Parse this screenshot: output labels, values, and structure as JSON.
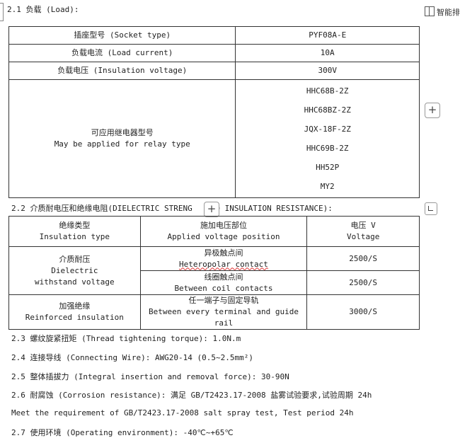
{
  "section_1": {
    "heading": "2.1 负载 (Load):",
    "rows": [
      {
        "label": "插座型号 (Socket type)",
        "value": "PYF08A-E"
      },
      {
        "label": "负载电流 (Load current)",
        "value": "10A"
      },
      {
        "label": "负载电压 (Insulation voltage)",
        "value": "300V"
      }
    ],
    "relay_label_cn": "可应用继电器型号",
    "relay_label_en": "May be applied for relay type",
    "relay_types": [
      "HHC68B-2Z",
      "HHC68BZ-2Z",
      "JQX-18F-2Z",
      "HHC69B-2Z",
      "HH52P",
      "MY2"
    ]
  },
  "section_2": {
    "heading": "2.2 介质耐电压和绝缘电阻(DIELECTRIC STRENG",
    "heading_tail": "ND INSULATION RESISTANCE):",
    "headers": [
      {
        "cn": "绝缘类型",
        "en": "Insulation type"
      },
      {
        "cn": "施加电压部位",
        "en": "Applied voltage position"
      },
      {
        "cn": "电压 V",
        "en": "Voltage"
      }
    ],
    "dielectric_cn": "介质耐压",
    "dielectric_en1": "Dielectric",
    "dielectric_en2": "withstand voltage",
    "hetero_cn": "异极触点间",
    "hetero_en": "Heteropolar contact",
    "hetero_voltage": "2500/S",
    "coil_cn": "线圈触点间",
    "coil_en": "Between coil contacts",
    "coil_voltage": "2500/S",
    "reinforced_cn": "加强绝缘",
    "reinforced_en": "Reinforced insulation",
    "terminal_cn": "任一端子与固定导轨",
    "terminal_en": "Between every terminal and guide rail",
    "terminal_voltage": "3000/S"
  },
  "lines": {
    "l1": "2.3 螺纹旋紧扭矩 (Thread tightening torque): 1.0N.m",
    "l2": "2.4 连接导线 (Connecting Wire): AWG20-14 (0.5~2.5mm²)",
    "l3": "2.5 整体插拔力 (Integral insertion and removal force): 30-90N",
    "l4": "2.6 耐腐蚀 (Corrosion resistance): 满足 GB/T2423.17-2008 盐雾试验要求,试验周期 24h",
    "l5": "Meet the requirement of GB/T2423.17-2008 salt spray test, Test period 24h",
    "l6": "2.7 使用环境 (Operating environment): -40℃~+65℃"
  },
  "toolbar": {
    "smart_label": "智能排",
    "plus_glyph": "+"
  },
  "icons": {
    "smart": "layout-icon",
    "plus": "plus-icon",
    "expand": "expand-icon"
  }
}
